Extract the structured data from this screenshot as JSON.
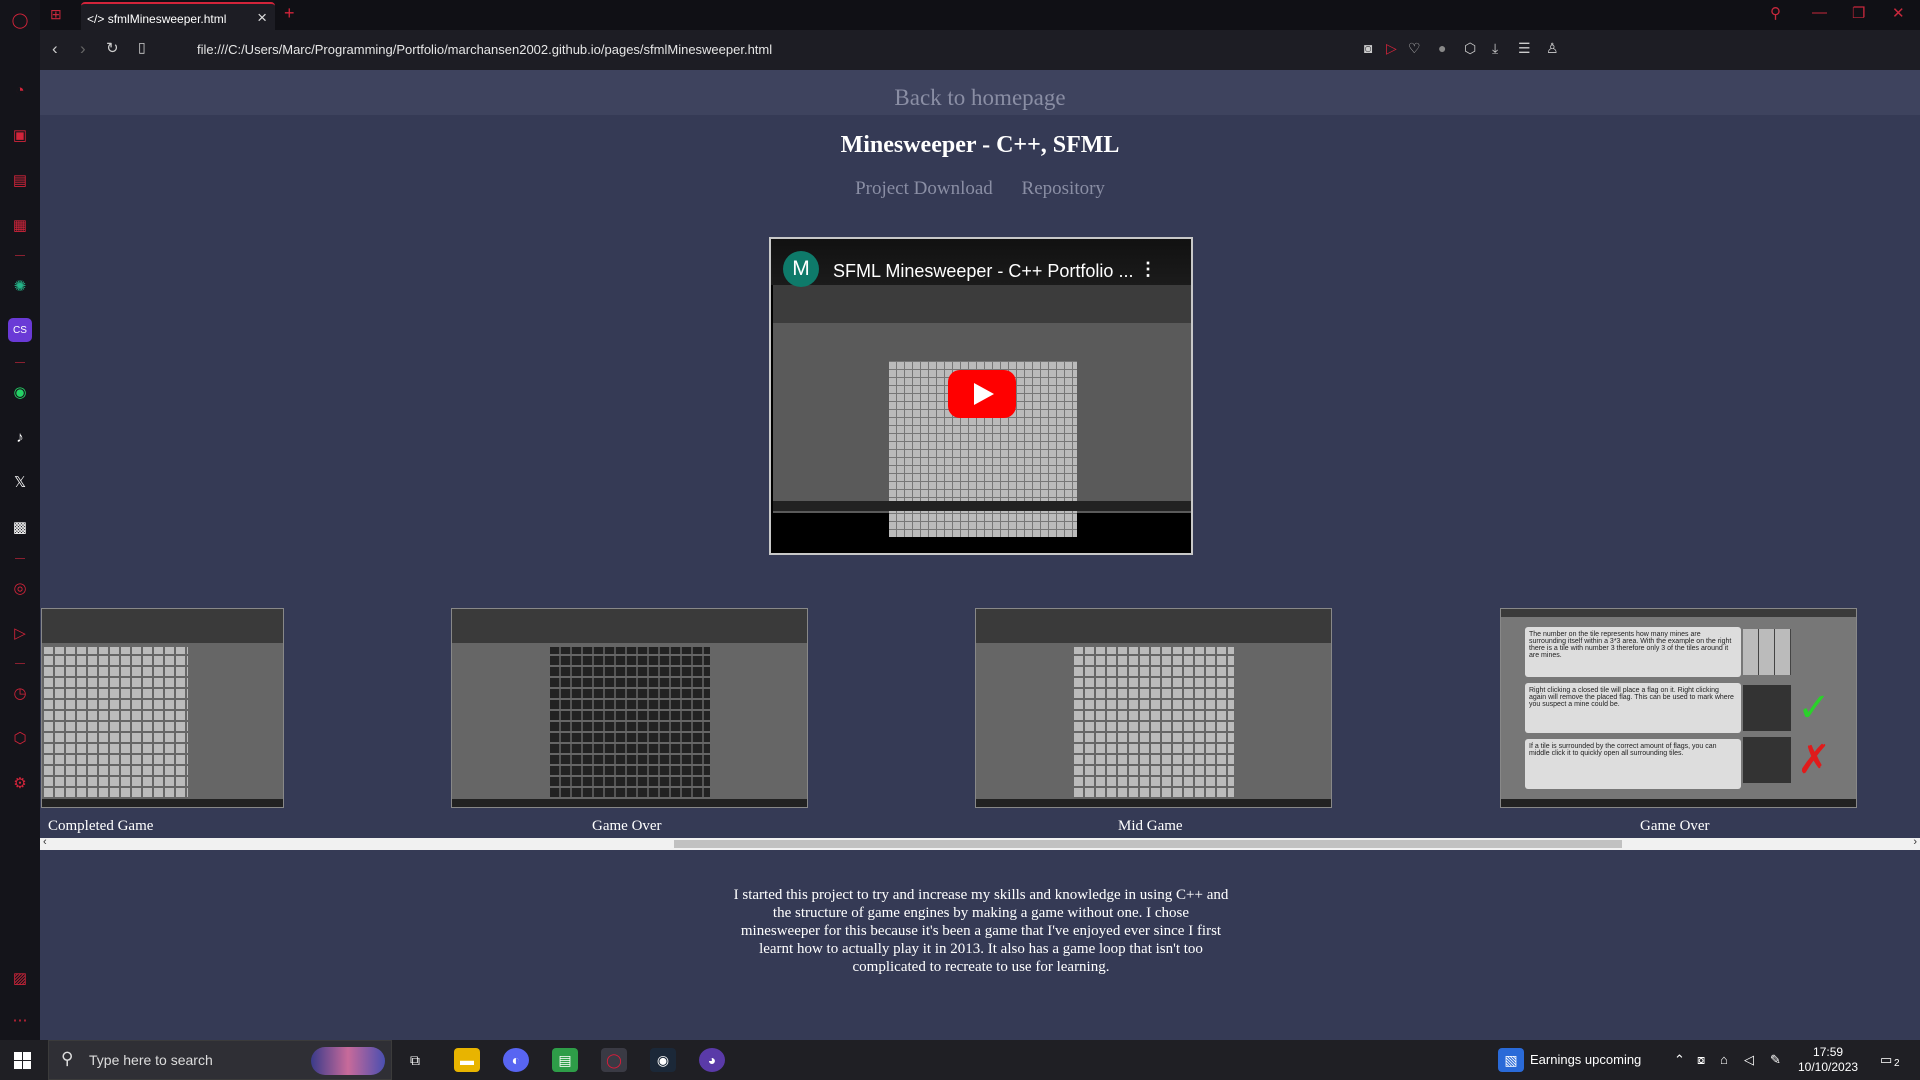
{
  "browser": {
    "tab_title": "sfmlMinesweeper.html",
    "tab_icon": "</>",
    "url": "file:///C:/Users/Marc/Programming/Portfolio/marchansen2002.github.io/pages/sfmlMinesweeper.html"
  },
  "page": {
    "back_link": "Back to homepage",
    "title": "Minesweeper - C++, SFML",
    "links": [
      "Project Download",
      "Repository"
    ],
    "video": {
      "avatar_letter": "M",
      "title": "SFML Minesweeper - C++ Portfolio ..."
    },
    "gallery": [
      {
        "caption": "Completed Game"
      },
      {
        "caption": "Game Over"
      },
      {
        "caption": "Mid Game"
      },
      {
        "caption": "Game Over"
      }
    ],
    "help_text": [
      "The number on the tile represents how many mines are surrounding itself within a 3*3 area. With the example on the right there is a tile with number 3 therefore only 3 of the tiles around it are mines.",
      "Right clicking a closed tile will place a flag on it. Right clicking again will remove the placed flag. This can be used to mark where you suspect a mine could be.",
      "If a tile is surrounded by the correct amount of flags, you can middle click it to quickly open all surrounding tiles."
    ],
    "description": "I started this project to try and increase my skills and knowledge in using C++ and the structure of game engines by making a game without one. I chose minesweeper for this because it's been a game that I've enjoyed ever since I first learnt how to actually play it in 2013. It also has a game loop that isn't too complicated to recreate to use for learning."
  },
  "taskbar": {
    "search_placeholder": "Type here to search",
    "news": "Earnings upcoming",
    "time": "17:59",
    "date": "10/10/2023",
    "notifications": "2"
  }
}
